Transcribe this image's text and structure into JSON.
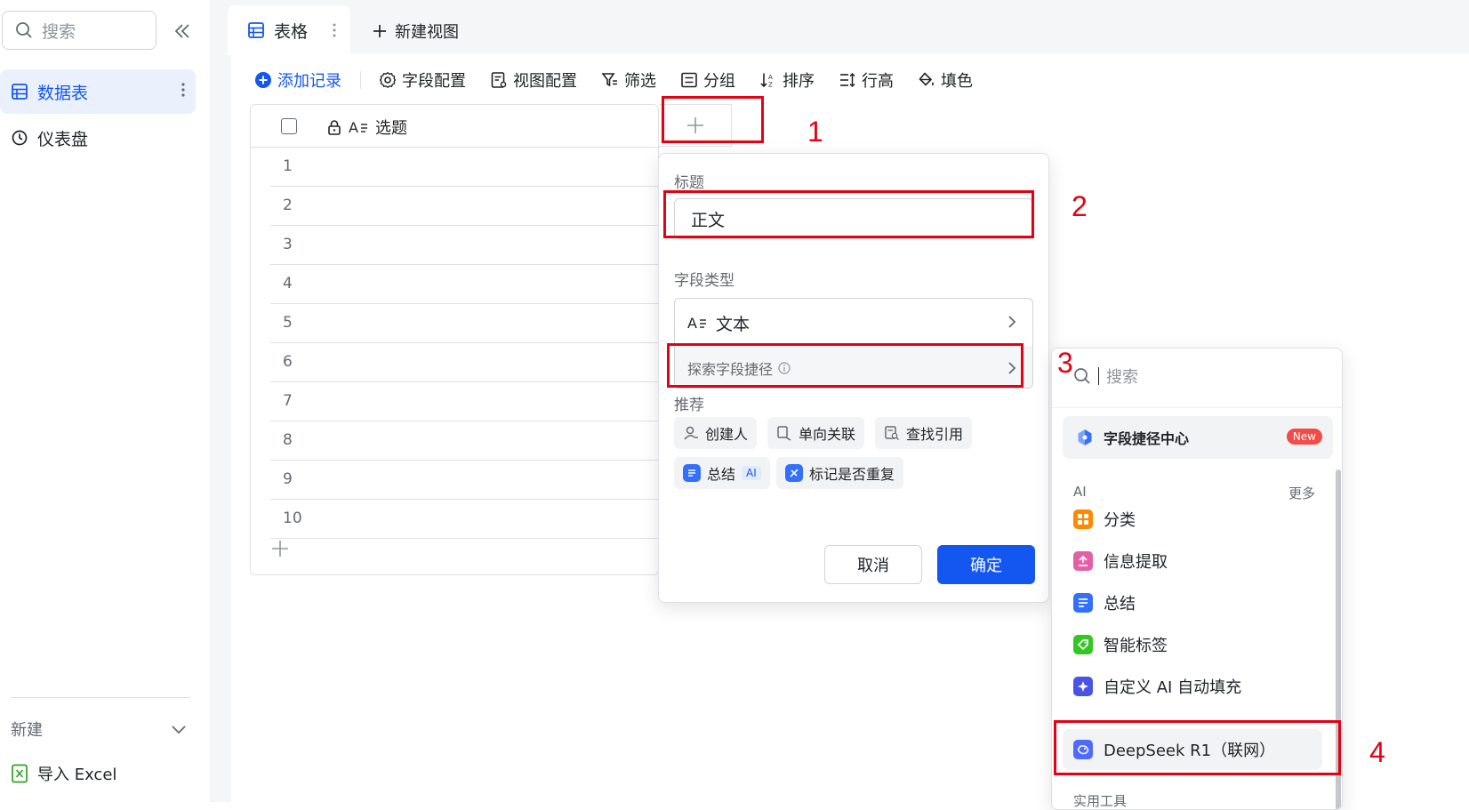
{
  "sidebar": {
    "search_placeholder": "搜索",
    "items": [
      {
        "label": "数据表",
        "active": true,
        "icon": "table-icon"
      },
      {
        "label": "仪表盘",
        "active": false,
        "icon": "dashboard-icon"
      }
    ],
    "new_label": "新建",
    "import_label": "导入 Excel"
  },
  "tabs": {
    "active_tab": "表格",
    "new_view": "新建视图"
  },
  "toolbar": {
    "add_record": "添加记录",
    "field_config": "字段配置",
    "view_config": "视图配置",
    "filter": "筛选",
    "group": "分组",
    "sort": "排序",
    "row_height": "行高",
    "fill_color": "填色"
  },
  "grid": {
    "field_name": "选题",
    "rows": [
      "1",
      "2",
      "3",
      "4",
      "5",
      "6",
      "7",
      "8",
      "9",
      "10"
    ]
  },
  "field_popup": {
    "title_label": "标题",
    "title_value": "正文",
    "type_label": "字段类型",
    "type_value": "文本",
    "explore_label": "探索字段捷径",
    "recommend_label": "推荐",
    "chips": [
      "创建人",
      "单向关联",
      "查找引用",
      "总结",
      "标记是否重复"
    ],
    "ai_tag": "AI",
    "cancel": "取消",
    "confirm": "确定"
  },
  "shortcut_panel": {
    "search_placeholder": "搜索",
    "center_label": "字段捷径中心",
    "new_badge": "New",
    "ai_section": "AI",
    "more": "更多",
    "items": [
      "分类",
      "信息提取",
      "总结",
      "智能标签",
      "自定义 AI 自动填充",
      "DeepSeek R1（联网）"
    ],
    "tools_section": "实用工具"
  },
  "annotations": [
    "1",
    "2",
    "3",
    "4"
  ],
  "colors": {
    "accent": "#1456f0",
    "annotation_red": "#e60012",
    "new_badge": "#f54a45"
  }
}
